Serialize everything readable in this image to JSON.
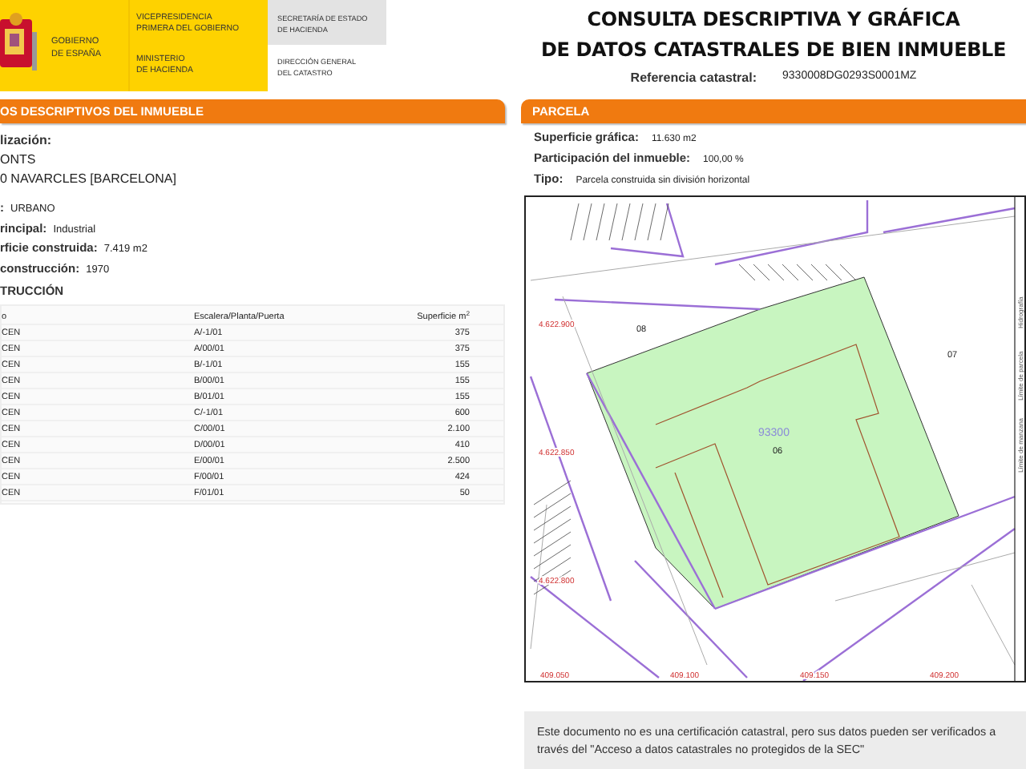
{
  "header": {
    "government": [
      "GOBIERNO",
      "DE ESPAÑA"
    ],
    "vicepresidency": [
      "VICEPRESIDENCIA",
      "PRIMERA DEL GOBIERNO"
    ],
    "ministry": [
      "MINISTERIO",
      "DE HACIENDA"
    ],
    "secretariat": [
      "SECRETARÍA DE ESTADO",
      "DE HACIENDA"
    ],
    "directorate": [
      "DIRECCIÓN GENERAL",
      "DEL CATASTRO"
    ]
  },
  "title": [
    "CONSULTA DESCRIPTIVA Y GRÁFICA",
    "DE DATOS CATASTRALES DE BIEN INMUEBLE"
  ],
  "reference": {
    "label": "Referencia catastral:",
    "value": "9330008DG0293S0001MZ"
  },
  "property": {
    "heading": "OS DESCRIPTIVOS DEL INMUEBLE",
    "location": {
      "label": "lización:",
      "lines": [
        "ONTS",
        "0 NAVARCLES [BARCELONA]"
      ]
    },
    "fields": [
      {
        "label": ": ",
        "value": "URBANO"
      },
      {
        "label": "rincipal:",
        "value": "Industrial"
      },
      {
        "label": "rficie construida:",
        "value": "7.419 m2"
      },
      {
        "label": "construcción:",
        "value": "1970"
      }
    ],
    "construction": {
      "heading": "TRUCCIÓN",
      "columns": [
        "o",
        "Escalera/Planta/Puerta",
        "Superficie m$^{2}$"
      ],
      "rows": [
        [
          "CEN",
          "A/-1/01",
          "375"
        ],
        [
          "CEN",
          "A/00/01",
          "375"
        ],
        [
          "CEN",
          "B/-1/01",
          "155"
        ],
        [
          "CEN",
          "B/00/01",
          "155"
        ],
        [
          "CEN",
          "B/01/01",
          "155"
        ],
        [
          "CEN",
          "C/-1/01",
          "600"
        ],
        [
          "CEN",
          "C/00/01",
          "2.100"
        ],
        [
          "CEN",
          "D/00/01",
          "410"
        ],
        [
          "CEN",
          "E/00/01",
          "2.500"
        ],
        [
          "CEN",
          "F/00/01",
          "424"
        ],
        [
          "CEN",
          "F/01/01",
          "50"
        ]
      ]
    }
  },
  "parcel": {
    "heading": "PARCELA",
    "fields": [
      {
        "label": "Superficie gráfica:",
        "value": "11.630 m2"
      },
      {
        "label": "Participación del inmueble:",
        "value": "100,00 %"
      },
      {
        "label": "Tipo:",
        "value": "Parcela construida sin división horizontal"
      }
    ],
    "map": {
      "parcels": [
        "08",
        "07",
        "06"
      ],
      "block": "93300",
      "y_coords": [
        "4.622.900",
        "4.622.850",
        "4.622.800"
      ],
      "x_coords": [
        "409.050",
        "409.100",
        "409.150",
        "409.200"
      ],
      "legend": [
        "Límite de manzana",
        "Límite de parcela",
        "Hidrografía"
      ]
    }
  },
  "notice": "Este documento no es una certificación catastral, pero sus datos pueden ser verificados a través del \"Acceso a datos catastrales no protegidos de la SEC\""
}
